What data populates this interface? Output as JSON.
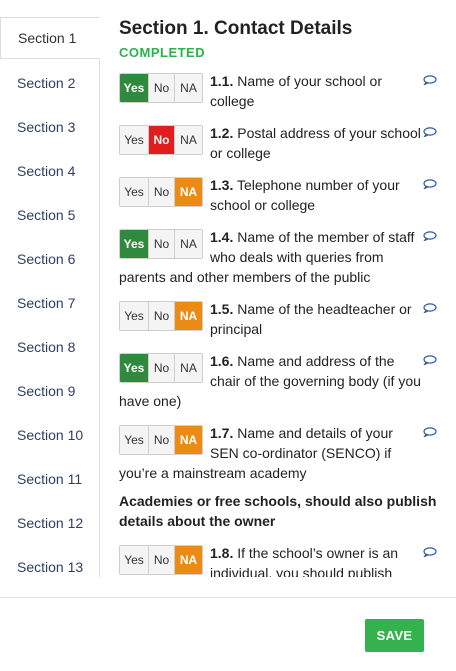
{
  "sidebar": {
    "items": [
      {
        "label": "Section 1"
      },
      {
        "label": "Section 2"
      },
      {
        "label": "Section 3"
      },
      {
        "label": "Section 4"
      },
      {
        "label": "Section 5"
      },
      {
        "label": "Section 6"
      },
      {
        "label": "Section 7"
      },
      {
        "label": "Section 8"
      },
      {
        "label": "Section 9"
      },
      {
        "label": "Section 10"
      },
      {
        "label": "Section 11"
      },
      {
        "label": "Section 12"
      },
      {
        "label": "Section 13"
      }
    ],
    "active_index": 0
  },
  "section": {
    "title": "Section 1. Contact Details",
    "status": "COMPLETED",
    "status_color": "#2bb24c"
  },
  "toggle_labels": {
    "yes": "Yes",
    "no": "No",
    "na": "NA"
  },
  "colors": {
    "yes_selected": "#2f8a3d",
    "no_selected": "#e21d1d",
    "na_selected": "#ec8b14",
    "link": "#2e3f63",
    "save": "#33b24e"
  },
  "questions": [
    {
      "number": "1.1.",
      "text": "Name of your school or college",
      "selected": "yes"
    },
    {
      "number": "1.2.",
      "text": "Postal address of your school or college",
      "selected": "no"
    },
    {
      "number": "1.3.",
      "text": "Telephone number of your school or college",
      "selected": "na"
    },
    {
      "number": "1.4.",
      "text": "Name of the member of staff who deals with queries from parents and other members of the public",
      "selected": "yes"
    },
    {
      "number": "1.5.",
      "text": "Name of the headteacher or principal",
      "selected": "na"
    },
    {
      "number": "1.6.",
      "text": "Name and address of the chair of the governing body (if you have one)",
      "selected": "yes"
    },
    {
      "number": "1.7.",
      "text": "Name and details of your SEN co-ordinator (SENCO) if you’re a mainstream academy",
      "selected": "na"
    },
    {
      "number": "1.8.",
      "text": "If the school’s owner is an individual, you should publish",
      "selected": "na"
    }
  ],
  "note": "Academies or free schools, should also publish details about the owner",
  "footer": {
    "save_label": "SAVE"
  },
  "icons": {
    "comment": "speech-bubble-icon"
  }
}
